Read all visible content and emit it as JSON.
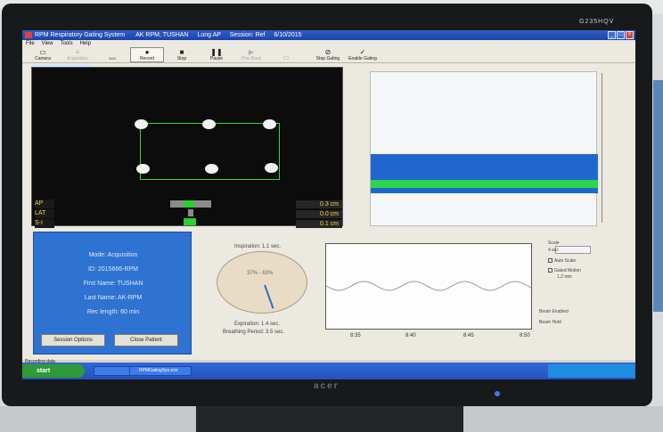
{
  "window": {
    "title": "RPM Respiratory Gating System",
    "patient": "AK RPM, TUSHAN",
    "site": "Lung AP",
    "session": "Session: Ref",
    "date": "6/10/2015"
  },
  "menu": [
    "File",
    "View",
    "Tools",
    "Help"
  ],
  "toolbar": [
    {
      "label": "Camera",
      "glyph": "▭",
      "pressed": false,
      "disabled": false
    },
    {
      "label": "Acquisition",
      "glyph": "≡",
      "pressed": false,
      "disabled": true
    },
    {
      "label": "",
      "glyph": "▬",
      "pressed": false,
      "disabled": true
    },
    {
      "label": "Record",
      "glyph": "●",
      "pressed": true,
      "disabled": false
    },
    {
      "label": "Stop",
      "glyph": "■",
      "pressed": false,
      "disabled": false
    },
    {
      "label": "Pause",
      "glyph": "❚❚",
      "pressed": false,
      "disabled": false
    },
    {
      "label": "Play Back",
      "glyph": "▶",
      "pressed": false,
      "disabled": true
    },
    {
      "label": "",
      "glyph": "▭",
      "pressed": false,
      "disabled": true
    },
    {
      "label": "Stop Gating",
      "glyph": "⊘",
      "pressed": false,
      "disabled": false
    },
    {
      "label": "Enable Gating",
      "glyph": "✓",
      "pressed": false,
      "disabled": false
    }
  ],
  "position": [
    {
      "axis": "AP",
      "value": "0.3 cm"
    },
    {
      "axis": "LAT",
      "value": "0.0 cm"
    },
    {
      "axis": "S-I",
      "value": "0.1 cm"
    }
  ],
  "info": {
    "mode": "Mode: Acquisition",
    "id": "ID: 2015666-RPM",
    "first_name": "First Name: TUSHAN",
    "last_name": "Last Name: AK-RPM",
    "rec_length": "Rec length: 60 min",
    "btn_options": "Session Options",
    "btn_close": "Close Patient"
  },
  "breathing": {
    "inspiration": "Inspiration: 1.1 sec.",
    "expiration": "Expiration: 1.4 sec.",
    "period": "Breathing Period: 3.5 sec.",
    "dial_text": "37% - 63%"
  },
  "trace_ticks": [
    "8:35",
    "8:40",
    "8:45",
    "8:50"
  ],
  "right_controls": {
    "scale": "Scale",
    "scale_value": "4 sec",
    "auto_scale": "Auto Scale",
    "gated_motion": "Gated Motion",
    "gated_motion_value": "1.2 mm",
    "beam_enabled": "Beam Enabled",
    "beam_hold": "Beam Hold"
  },
  "status": "Recording data",
  "taskbar": {
    "start": "start",
    "task": "RPMGatingSys.exe"
  },
  "monitor": {
    "brand": "G235HQV",
    "logo": "acer"
  }
}
